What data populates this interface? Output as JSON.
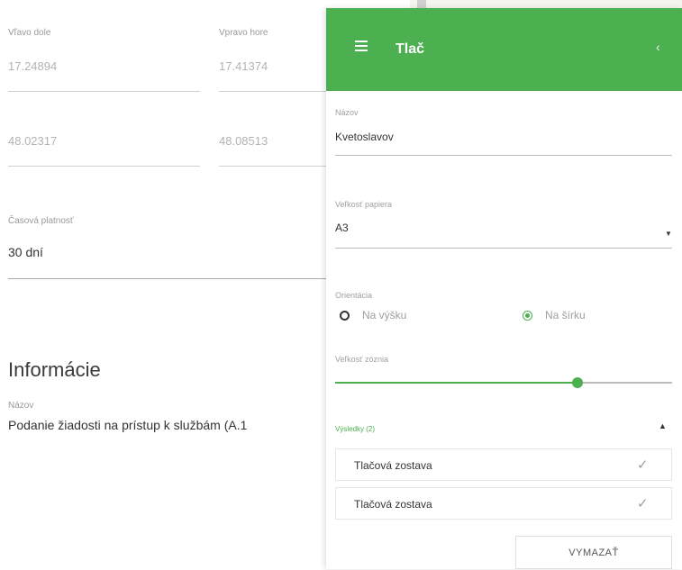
{
  "left": {
    "bottom_left_label": "Vľavo dole",
    "top_right_label": "Vpravo hore",
    "bottom_left_x": "17.24894",
    "top_right_x": "17.41374",
    "bottom_left_y": "48.02317",
    "top_right_y": "48.08513",
    "validity_label": "Časová platnosť",
    "validity_value": "30 dní",
    "info_heading": "Informácie",
    "name_label": "Názov",
    "name_value": "Podanie žiadosti na prístup k službám (A.1"
  },
  "panel": {
    "title": "Tlač",
    "name_label": "Názov",
    "name_value": "Kvetoslavov",
    "paper_label": "Veľkosť papiera",
    "paper_value": "A3",
    "orientation_label": "Orientácia",
    "orientation_portrait": "Na výšku",
    "orientation_landscape": "Na šírku",
    "orientation_selected": "Na šírku",
    "scale_label": "Veľkosť zóznia",
    "scale_fraction": 0.72,
    "results_label": "Výsledky (2)",
    "results": [
      {
        "label": "Tlačová zostava"
      },
      {
        "label": "Tlačová zostava"
      }
    ],
    "clear_button": "VYMAZAŤ"
  },
  "colors": {
    "accent": "#4caf50"
  }
}
